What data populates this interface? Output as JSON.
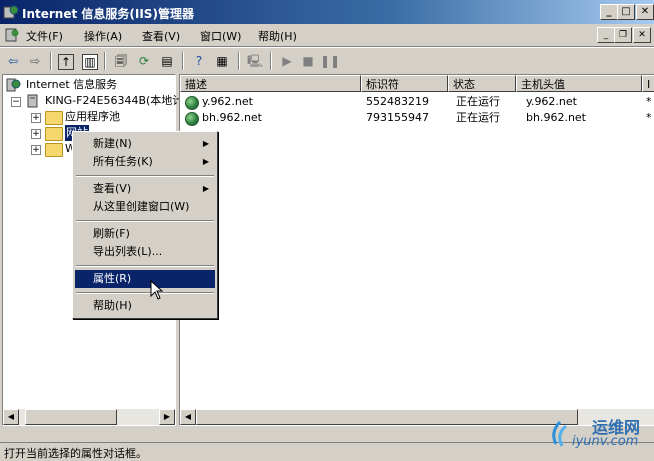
{
  "window": {
    "title": "Internet 信息服务(IIS)管理器"
  },
  "menubar": [
    "文件(F)",
    "操作(A)",
    "查看(V)",
    "窗口(W)",
    "帮助(H)"
  ],
  "tree": {
    "root": "Internet 信息服务",
    "server": "KING-F24E56344B(本地计",
    "children": [
      "应用程序池",
      "网站",
      "W"
    ]
  },
  "list": {
    "columns": [
      "描述",
      "标识符",
      "状态",
      "主机头值",
      "I"
    ],
    "rows": [
      {
        "desc": "y.962.net",
        "id": "552483219",
        "status": "正在运行",
        "host": "y.962.net",
        "extra": "*"
      },
      {
        "desc": "bh.962.net",
        "id": "793155947",
        "status": "正在运行",
        "host": "bh.962.net",
        "extra": "*"
      }
    ]
  },
  "context_menu": {
    "items": [
      "新建(N)",
      "所有任务(K)",
      "查看(V)",
      "从这里创建窗口(W)",
      "刷新(F)",
      "导出列表(L)...",
      "属性(R)",
      "帮助(H)"
    ],
    "selected": "属性(R)"
  },
  "statusbar": {
    "text": "打开当前选择的属性对话框。"
  },
  "watermark": {
    "brand": "运维网",
    "url": "iyunv.com"
  },
  "colors": {
    "titlebar": "#0a246a",
    "selection": "#0a246a",
    "face": "#d4d0c8"
  }
}
